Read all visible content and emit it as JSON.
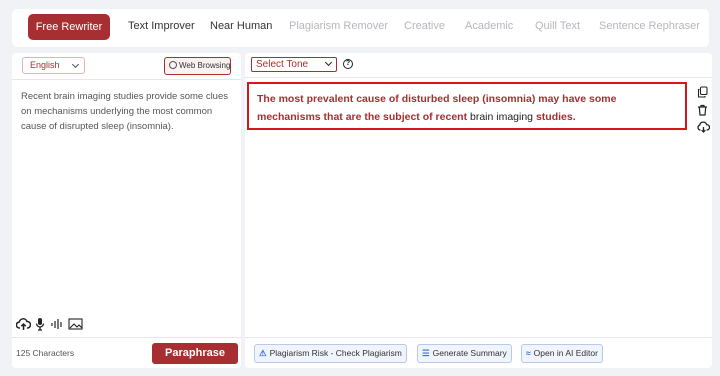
{
  "tabs": [
    {
      "label": "Free Rewriter"
    },
    {
      "label": "Text Improver"
    },
    {
      "label": "Near Human"
    },
    {
      "label": "Plagiarism Remover"
    },
    {
      "label": "Creative"
    },
    {
      "label": "Academic"
    },
    {
      "label": "Quill Text"
    },
    {
      "label": "Sentence Rephraser"
    }
  ],
  "input_panel": {
    "language": "English",
    "web_browsing_label": "Web Browsing",
    "source_text": "Recent brain imaging studies provide some clues on mechanisms underlying the most common cause of disrupted sleep (insomnia).",
    "char_count": "125 Characters",
    "paraphrase_label": "Paraphrase"
  },
  "output_panel": {
    "tone_placeholder": "Select Tone",
    "help_glyph": "?",
    "output_segments": [
      {
        "text": "The most prevalent cause of disturbed sleep (insomnia) may have some mechanisms that are the subject of recent ",
        "changed": true
      },
      {
        "text": "brain imaging ",
        "changed": false
      },
      {
        "text": "studies.",
        "changed": true
      }
    ],
    "buttons": {
      "plagiarism": "Plagiarism Risk - Check Plagiarism",
      "summary": "Generate Summary",
      "ai_editor": "Open in AI Editor"
    }
  },
  "colors": {
    "accent": "#a72f31",
    "highlight_border": "#d8141c",
    "button_blue": "#3a6fd8"
  },
  "icons": [
    "cloud-upload-icon",
    "microphone-icon",
    "audio-wave-icon",
    "image-icon",
    "globe-icon",
    "help-icon",
    "copy-icon",
    "trash-icon",
    "cloud-download-icon",
    "warning-icon",
    "summary-icon",
    "ai-editor-icon"
  ]
}
